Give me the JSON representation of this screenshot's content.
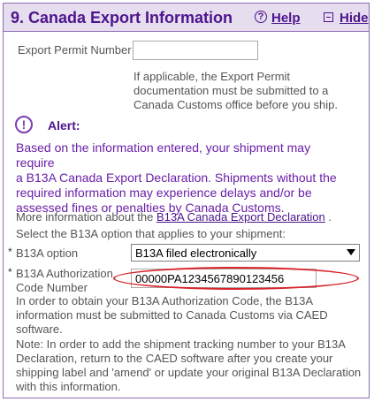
{
  "header": {
    "title": "9. Canada Export Information",
    "help_label": "Help",
    "hide_label": "Hide"
  },
  "export_permit": {
    "label": "Export Permit Number",
    "value": "",
    "note_lines": [
      "If applicable, the Export Permit",
      "documentation must be submitted to a",
      "Canada Customs office before you ship."
    ]
  },
  "alert": {
    "title": "Alert:",
    "lines": [
      "Based on the information entered, your shipment may require",
      "a B13A Canada Export Declaration. Shipments without the",
      "required information may experience delays and/or be",
      "assessed fines or penalties by Canada Customs."
    ]
  },
  "more_info": {
    "prefix": "More information about the ",
    "link": "B13A Canada Export Declaration",
    "suffix": " ."
  },
  "select_instruction": "Select the B13A option that applies to your shipment:",
  "b13a_option": {
    "required_mark": "*",
    "label": "B13A option",
    "selected": "B13A filed electronically"
  },
  "b13a_code": {
    "required_mark": "*",
    "label_lines": [
      "B13A Authorization",
      "Code Number"
    ],
    "value": "00000PA1234567890123456"
  },
  "info_text": [
    "In order to obtain your B13A Authorization Code, the B13A",
    "information must be submitted to Canada Customs via CAED",
    "software."
  ],
  "note_text": [
    "Note: In order to add the shipment tracking number to your B13A",
    "Declaration, return to the CAED software after you create your",
    "shipping label and 'amend' or update your original B13A Declaration",
    "with this information."
  ],
  "colors": {
    "brand_purple": "#4d148c",
    "alert_purple": "#6a1fa8",
    "highlight_red": "#d9232a"
  }
}
